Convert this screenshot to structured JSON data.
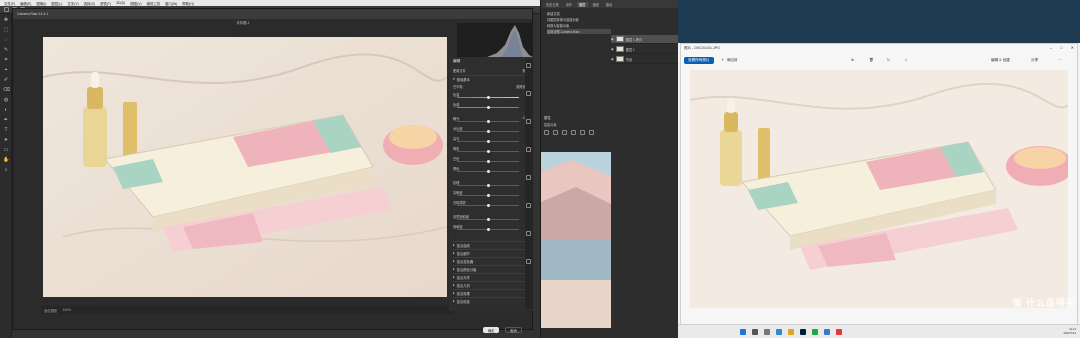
{
  "ps": {
    "menu": [
      "文件(F)",
      "编辑(E)",
      "图像(I)",
      "图层(L)",
      "文字(Y)",
      "选择(S)",
      "滤镜(T)",
      "3D(D)",
      "视图(V)",
      "增效工具",
      "窗口(W)",
      "帮助(H)"
    ]
  },
  "acr": {
    "title": "Camera Raw 14.4.1",
    "filename": "未标题-1",
    "zoom": "适合视图",
    "zoom_pct": "100%",
    "panel_title": "编辑",
    "profile_label": "配置文件",
    "profile_value": "颜色",
    "basic_section": "基础基本",
    "wb_label": "白平衡",
    "wb_value": "原照设置",
    "sliders": [
      {
        "label": "色温",
        "value": "0"
      },
      {
        "label": "色调",
        "value": "0"
      },
      {
        "label": "曝光",
        "value": "0.00"
      },
      {
        "label": "对比度",
        "value": "0"
      },
      {
        "label": "高光",
        "value": "0"
      },
      {
        "label": "阴影",
        "value": "0"
      },
      {
        "label": "白色",
        "value": "0"
      },
      {
        "label": "黑色",
        "value": "0"
      },
      {
        "label": "纹理",
        "value": "0"
      },
      {
        "label": "清晰度",
        "value": "0"
      },
      {
        "label": "去除薄雾",
        "value": "0"
      },
      {
        "label": "自然饱和度",
        "value": "0"
      },
      {
        "label": "饱和度",
        "value": "0"
      }
    ],
    "sections": [
      "混合曲线",
      "混合细节",
      "混合混色器",
      "混合颜色分级",
      "混合光学",
      "混合几何",
      "混合效果",
      "混合校准"
    ],
    "ok_label": "确定",
    "cancel_label": "取消"
  },
  "panels": {
    "tabs": [
      "历史记录",
      "动作",
      "图层",
      "通道",
      "路径"
    ],
    "history": [
      "新建文档",
      "将图层转换为智能对象",
      "转换为智能对象",
      "应用滤镜-Camera Raw"
    ],
    "layers": [
      "图层 1 拷贝",
      "图层 1",
      "背景"
    ],
    "props_title": "属性",
    "props_sub": "智能对象"
  },
  "photos": {
    "title": "照片 - DSC04101.JPG",
    "edit_btn": "查看所有照片",
    "add_btn": "添加到",
    "edit_image": "编辑 & 创建",
    "share": "分享"
  },
  "taskbar": {
    "time": "11:21",
    "date": "2022/7/14"
  },
  "watermark": "值 什么值得买"
}
